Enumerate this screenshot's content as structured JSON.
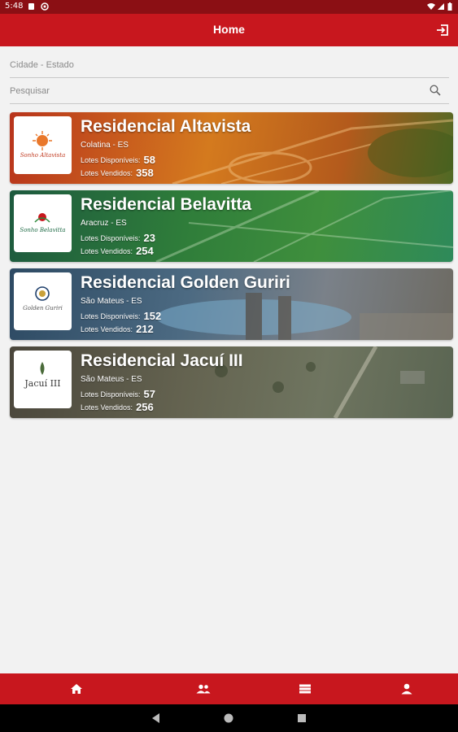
{
  "status_bar": {
    "time": "5:48",
    "icons": [
      "sim-icon",
      "notification-icon",
      "wifi-icon",
      "signal-icon",
      "battery-icon"
    ]
  },
  "app_bar": {
    "title": "Home",
    "action_icon": "logout-icon"
  },
  "filters": {
    "city_state_placeholder": "Cidade - Estado",
    "search_placeholder": "Pesquisar"
  },
  "labels": {
    "available": "Lotes Disponíveis:",
    "sold": "Lotes Vendidos:"
  },
  "developments": [
    {
      "name": "Residencial Altavista",
      "location": "Colatina - ES",
      "available": "58",
      "sold": "358",
      "logo_text": "Sonho Altavista",
      "colors": [
        "#c0391f",
        "#d9861c",
        "#6a7a2a"
      ]
    },
    {
      "name": "Residencial Belavitta",
      "location": "Aracruz - ES",
      "available": "23",
      "sold": "254",
      "logo_text": "Sonho Belavitta",
      "colors": [
        "#1f6b46",
        "#2f8a3c",
        "#3a9a52"
      ]
    },
    {
      "name": "Residencial Golden Guriri",
      "location": "São Mateus - ES",
      "available": "152",
      "sold": "212",
      "logo_text": "Golden Guriri",
      "colors": [
        "#34506a",
        "#5f7280",
        "#7b7d7a"
      ]
    },
    {
      "name": "Residencial Jacuí III",
      "location": "São Mateus - ES",
      "available": "57",
      "sold": "256",
      "logo_text": "Jacuí III",
      "colors": [
        "#4e4a3e",
        "#6b6b55",
        "#5b6550"
      ]
    }
  ],
  "bottom_nav": [
    "home-icon",
    "people-icon",
    "list-icon",
    "person-icon"
  ],
  "system_nav": [
    "back-icon",
    "home-circle-icon",
    "recents-icon"
  ],
  "theme": {
    "primary": "#c8171e",
    "status": "#8b0f14"
  }
}
